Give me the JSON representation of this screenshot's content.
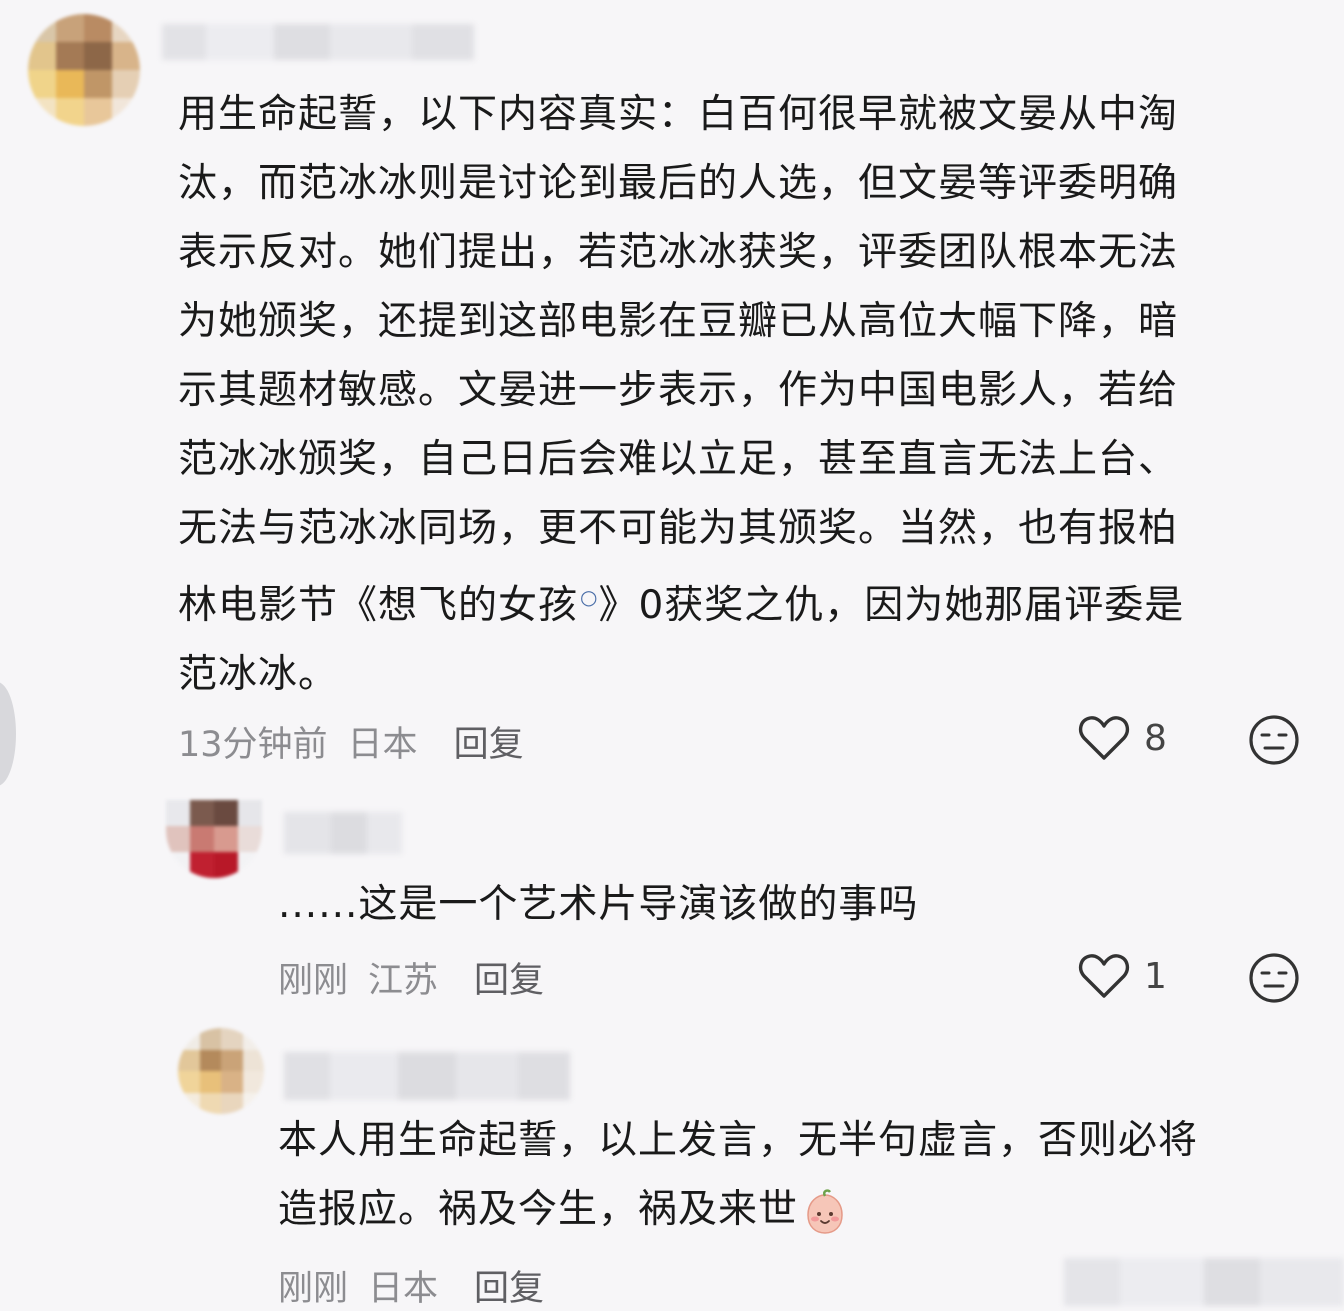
{
  "comments": [
    {
      "text_lines": [
        "用生命起誓，以下内容真实：白百何很早就被文晏从中淘",
        "汰，而范冰冰则是讨论到最后的人选，但文晏等评委明确",
        "表示反对。她们提出，若范冰冰获奖，评委团队根本无法",
        "为她颁奖，还提到这部电影在豆瓣已从高位大幅下降，暗",
        "示其题材敏感。文晏进一步表示，作为中国电影人，若给",
        "范冰冰颁奖，自己日后会难以立足，甚至直言无法上台、",
        "无法与范冰冰同场，更不可能为其颁奖。当然，也有报柏"
      ],
      "line8_prefix": "林电影节《",
      "line8_link": "想飞的女孩",
      "line8_suffix": "》0获奖之仇，因为她那届评委是",
      "last_line": "范冰冰。",
      "time": "13分钟前",
      "location": "日本",
      "reply": "回复",
      "likes": "8"
    },
    {
      "text": "......这是一个艺术片导演该做的事吗",
      "time": "刚刚",
      "location": "江苏",
      "reply": "回复",
      "likes": "1"
    },
    {
      "line1": "本人用生命起誓，以上发言，无半句虚言，否则必将",
      "line2": "造报应。祸及今生，祸及来世",
      "time": "刚刚",
      "location": "日本",
      "reply": "回复"
    }
  ],
  "icons": {
    "like": "heart-outline-icon",
    "dislike": "neutral-face-icon",
    "search": "search-icon",
    "emoji": "peach-smile-emoji"
  },
  "colors": {
    "background": "#f7f6f8",
    "meta_text": "#8c8c90"
  }
}
